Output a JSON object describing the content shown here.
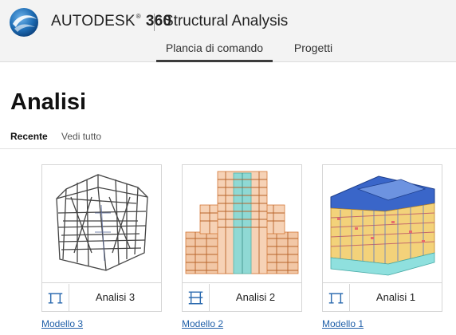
{
  "header": {
    "brand": "AUTODESK",
    "brand_reg": "®",
    "brand_num": "360",
    "product": "Structural Analysis"
  },
  "nav": {
    "items": [
      {
        "label": "Plancia di comando",
        "active": true
      },
      {
        "label": "Progetti",
        "active": false
      }
    ]
  },
  "page": {
    "title": "Analisi"
  },
  "tabs": [
    {
      "label": "Recente",
      "active": true
    },
    {
      "label": "Vedi tutto",
      "active": false
    }
  ],
  "cards": [
    {
      "label": "Analisi 3",
      "model_link": "Modello 3",
      "icon": "frame-structure-icon"
    },
    {
      "label": "Analisi 2",
      "model_link": "Modello 2",
      "icon": "frame-structure-icon"
    },
    {
      "label": "Analisi 1",
      "model_link": "Modello 1",
      "icon": "frame-structure-icon"
    }
  ],
  "colors": {
    "link": "#1f5fa8",
    "topbar": "#f3f3f3",
    "logo_primary": "#1e6db5"
  }
}
